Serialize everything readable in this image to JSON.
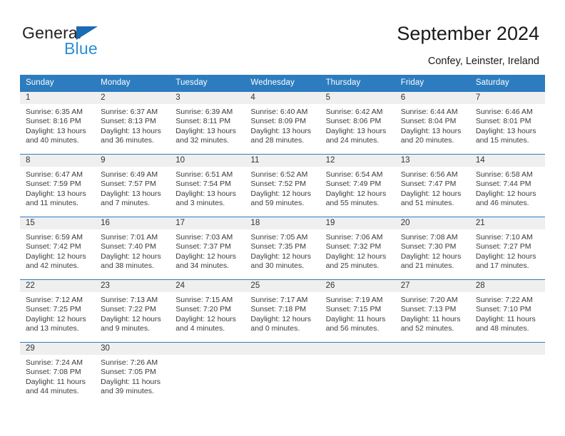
{
  "brand": {
    "name_top": "General",
    "name_bottom": "Blue",
    "triangle_color": "#1b6cb3",
    "text_color": "#231f20",
    "blue_text_color": "#2c8ed6"
  },
  "header": {
    "title": "September 2024",
    "subtitle": "Confey, Leinster, Ireland"
  },
  "theme": {
    "header_bg": "#2c7cbf",
    "header_text": "#ffffff",
    "daynum_bg": "#efefef",
    "cell_bg": "#ffffff",
    "body_text": "#3b3b3b"
  },
  "calendar": {
    "weekday_headers": [
      "Sunday",
      "Monday",
      "Tuesday",
      "Wednesday",
      "Thursday",
      "Friday",
      "Saturday"
    ],
    "weeks": [
      [
        {
          "day": "1",
          "sunrise": "Sunrise: 6:35 AM",
          "sunset": "Sunset: 8:16 PM",
          "daylight_1": "Daylight: 13 hours",
          "daylight_2": "and 40 minutes."
        },
        {
          "day": "2",
          "sunrise": "Sunrise: 6:37 AM",
          "sunset": "Sunset: 8:13 PM",
          "daylight_1": "Daylight: 13 hours",
          "daylight_2": "and 36 minutes."
        },
        {
          "day": "3",
          "sunrise": "Sunrise: 6:39 AM",
          "sunset": "Sunset: 8:11 PM",
          "daylight_1": "Daylight: 13 hours",
          "daylight_2": "and 32 minutes."
        },
        {
          "day": "4",
          "sunrise": "Sunrise: 6:40 AM",
          "sunset": "Sunset: 8:09 PM",
          "daylight_1": "Daylight: 13 hours",
          "daylight_2": "and 28 minutes."
        },
        {
          "day": "5",
          "sunrise": "Sunrise: 6:42 AM",
          "sunset": "Sunset: 8:06 PM",
          "daylight_1": "Daylight: 13 hours",
          "daylight_2": "and 24 minutes."
        },
        {
          "day": "6",
          "sunrise": "Sunrise: 6:44 AM",
          "sunset": "Sunset: 8:04 PM",
          "daylight_1": "Daylight: 13 hours",
          "daylight_2": "and 20 minutes."
        },
        {
          "day": "7",
          "sunrise": "Sunrise: 6:46 AM",
          "sunset": "Sunset: 8:01 PM",
          "daylight_1": "Daylight: 13 hours",
          "daylight_2": "and 15 minutes."
        }
      ],
      [
        {
          "day": "8",
          "sunrise": "Sunrise: 6:47 AM",
          "sunset": "Sunset: 7:59 PM",
          "daylight_1": "Daylight: 13 hours",
          "daylight_2": "and 11 minutes."
        },
        {
          "day": "9",
          "sunrise": "Sunrise: 6:49 AM",
          "sunset": "Sunset: 7:57 PM",
          "daylight_1": "Daylight: 13 hours",
          "daylight_2": "and 7 minutes."
        },
        {
          "day": "10",
          "sunrise": "Sunrise: 6:51 AM",
          "sunset": "Sunset: 7:54 PM",
          "daylight_1": "Daylight: 13 hours",
          "daylight_2": "and 3 minutes."
        },
        {
          "day": "11",
          "sunrise": "Sunrise: 6:52 AM",
          "sunset": "Sunset: 7:52 PM",
          "daylight_1": "Daylight: 12 hours",
          "daylight_2": "and 59 minutes."
        },
        {
          "day": "12",
          "sunrise": "Sunrise: 6:54 AM",
          "sunset": "Sunset: 7:49 PM",
          "daylight_1": "Daylight: 12 hours",
          "daylight_2": "and 55 minutes."
        },
        {
          "day": "13",
          "sunrise": "Sunrise: 6:56 AM",
          "sunset": "Sunset: 7:47 PM",
          "daylight_1": "Daylight: 12 hours",
          "daylight_2": "and 51 minutes."
        },
        {
          "day": "14",
          "sunrise": "Sunrise: 6:58 AM",
          "sunset": "Sunset: 7:44 PM",
          "daylight_1": "Daylight: 12 hours",
          "daylight_2": "and 46 minutes."
        }
      ],
      [
        {
          "day": "15",
          "sunrise": "Sunrise: 6:59 AM",
          "sunset": "Sunset: 7:42 PM",
          "daylight_1": "Daylight: 12 hours",
          "daylight_2": "and 42 minutes."
        },
        {
          "day": "16",
          "sunrise": "Sunrise: 7:01 AM",
          "sunset": "Sunset: 7:40 PM",
          "daylight_1": "Daylight: 12 hours",
          "daylight_2": "and 38 minutes."
        },
        {
          "day": "17",
          "sunrise": "Sunrise: 7:03 AM",
          "sunset": "Sunset: 7:37 PM",
          "daylight_1": "Daylight: 12 hours",
          "daylight_2": "and 34 minutes."
        },
        {
          "day": "18",
          "sunrise": "Sunrise: 7:05 AM",
          "sunset": "Sunset: 7:35 PM",
          "daylight_1": "Daylight: 12 hours",
          "daylight_2": "and 30 minutes."
        },
        {
          "day": "19",
          "sunrise": "Sunrise: 7:06 AM",
          "sunset": "Sunset: 7:32 PM",
          "daylight_1": "Daylight: 12 hours",
          "daylight_2": "and 25 minutes."
        },
        {
          "day": "20",
          "sunrise": "Sunrise: 7:08 AM",
          "sunset": "Sunset: 7:30 PM",
          "daylight_1": "Daylight: 12 hours",
          "daylight_2": "and 21 minutes."
        },
        {
          "day": "21",
          "sunrise": "Sunrise: 7:10 AM",
          "sunset": "Sunset: 7:27 PM",
          "daylight_1": "Daylight: 12 hours",
          "daylight_2": "and 17 minutes."
        }
      ],
      [
        {
          "day": "22",
          "sunrise": "Sunrise: 7:12 AM",
          "sunset": "Sunset: 7:25 PM",
          "daylight_1": "Daylight: 12 hours",
          "daylight_2": "and 13 minutes."
        },
        {
          "day": "23",
          "sunrise": "Sunrise: 7:13 AM",
          "sunset": "Sunset: 7:22 PM",
          "daylight_1": "Daylight: 12 hours",
          "daylight_2": "and 9 minutes."
        },
        {
          "day": "24",
          "sunrise": "Sunrise: 7:15 AM",
          "sunset": "Sunset: 7:20 PM",
          "daylight_1": "Daylight: 12 hours",
          "daylight_2": "and 4 minutes."
        },
        {
          "day": "25",
          "sunrise": "Sunrise: 7:17 AM",
          "sunset": "Sunset: 7:18 PM",
          "daylight_1": "Daylight: 12 hours",
          "daylight_2": "and 0 minutes."
        },
        {
          "day": "26",
          "sunrise": "Sunrise: 7:19 AM",
          "sunset": "Sunset: 7:15 PM",
          "daylight_1": "Daylight: 11 hours",
          "daylight_2": "and 56 minutes."
        },
        {
          "day": "27",
          "sunrise": "Sunrise: 7:20 AM",
          "sunset": "Sunset: 7:13 PM",
          "daylight_1": "Daylight: 11 hours",
          "daylight_2": "and 52 minutes."
        },
        {
          "day": "28",
          "sunrise": "Sunrise: 7:22 AM",
          "sunset": "Sunset: 7:10 PM",
          "daylight_1": "Daylight: 11 hours",
          "daylight_2": "and 48 minutes."
        }
      ],
      [
        {
          "day": "29",
          "sunrise": "Sunrise: 7:24 AM",
          "sunset": "Sunset: 7:08 PM",
          "daylight_1": "Daylight: 11 hours",
          "daylight_2": "and 44 minutes."
        },
        {
          "day": "30",
          "sunrise": "Sunrise: 7:26 AM",
          "sunset": "Sunset: 7:05 PM",
          "daylight_1": "Daylight: 11 hours",
          "daylight_2": "and 39 minutes."
        },
        {
          "day": "",
          "sunrise": "",
          "sunset": "",
          "daylight_1": "",
          "daylight_2": ""
        },
        {
          "day": "",
          "sunrise": "",
          "sunset": "",
          "daylight_1": "",
          "daylight_2": ""
        },
        {
          "day": "",
          "sunrise": "",
          "sunset": "",
          "daylight_1": "",
          "daylight_2": ""
        },
        {
          "day": "",
          "sunrise": "",
          "sunset": "",
          "daylight_1": "",
          "daylight_2": ""
        },
        {
          "day": "",
          "sunrise": "",
          "sunset": "",
          "daylight_1": "",
          "daylight_2": ""
        }
      ]
    ]
  }
}
